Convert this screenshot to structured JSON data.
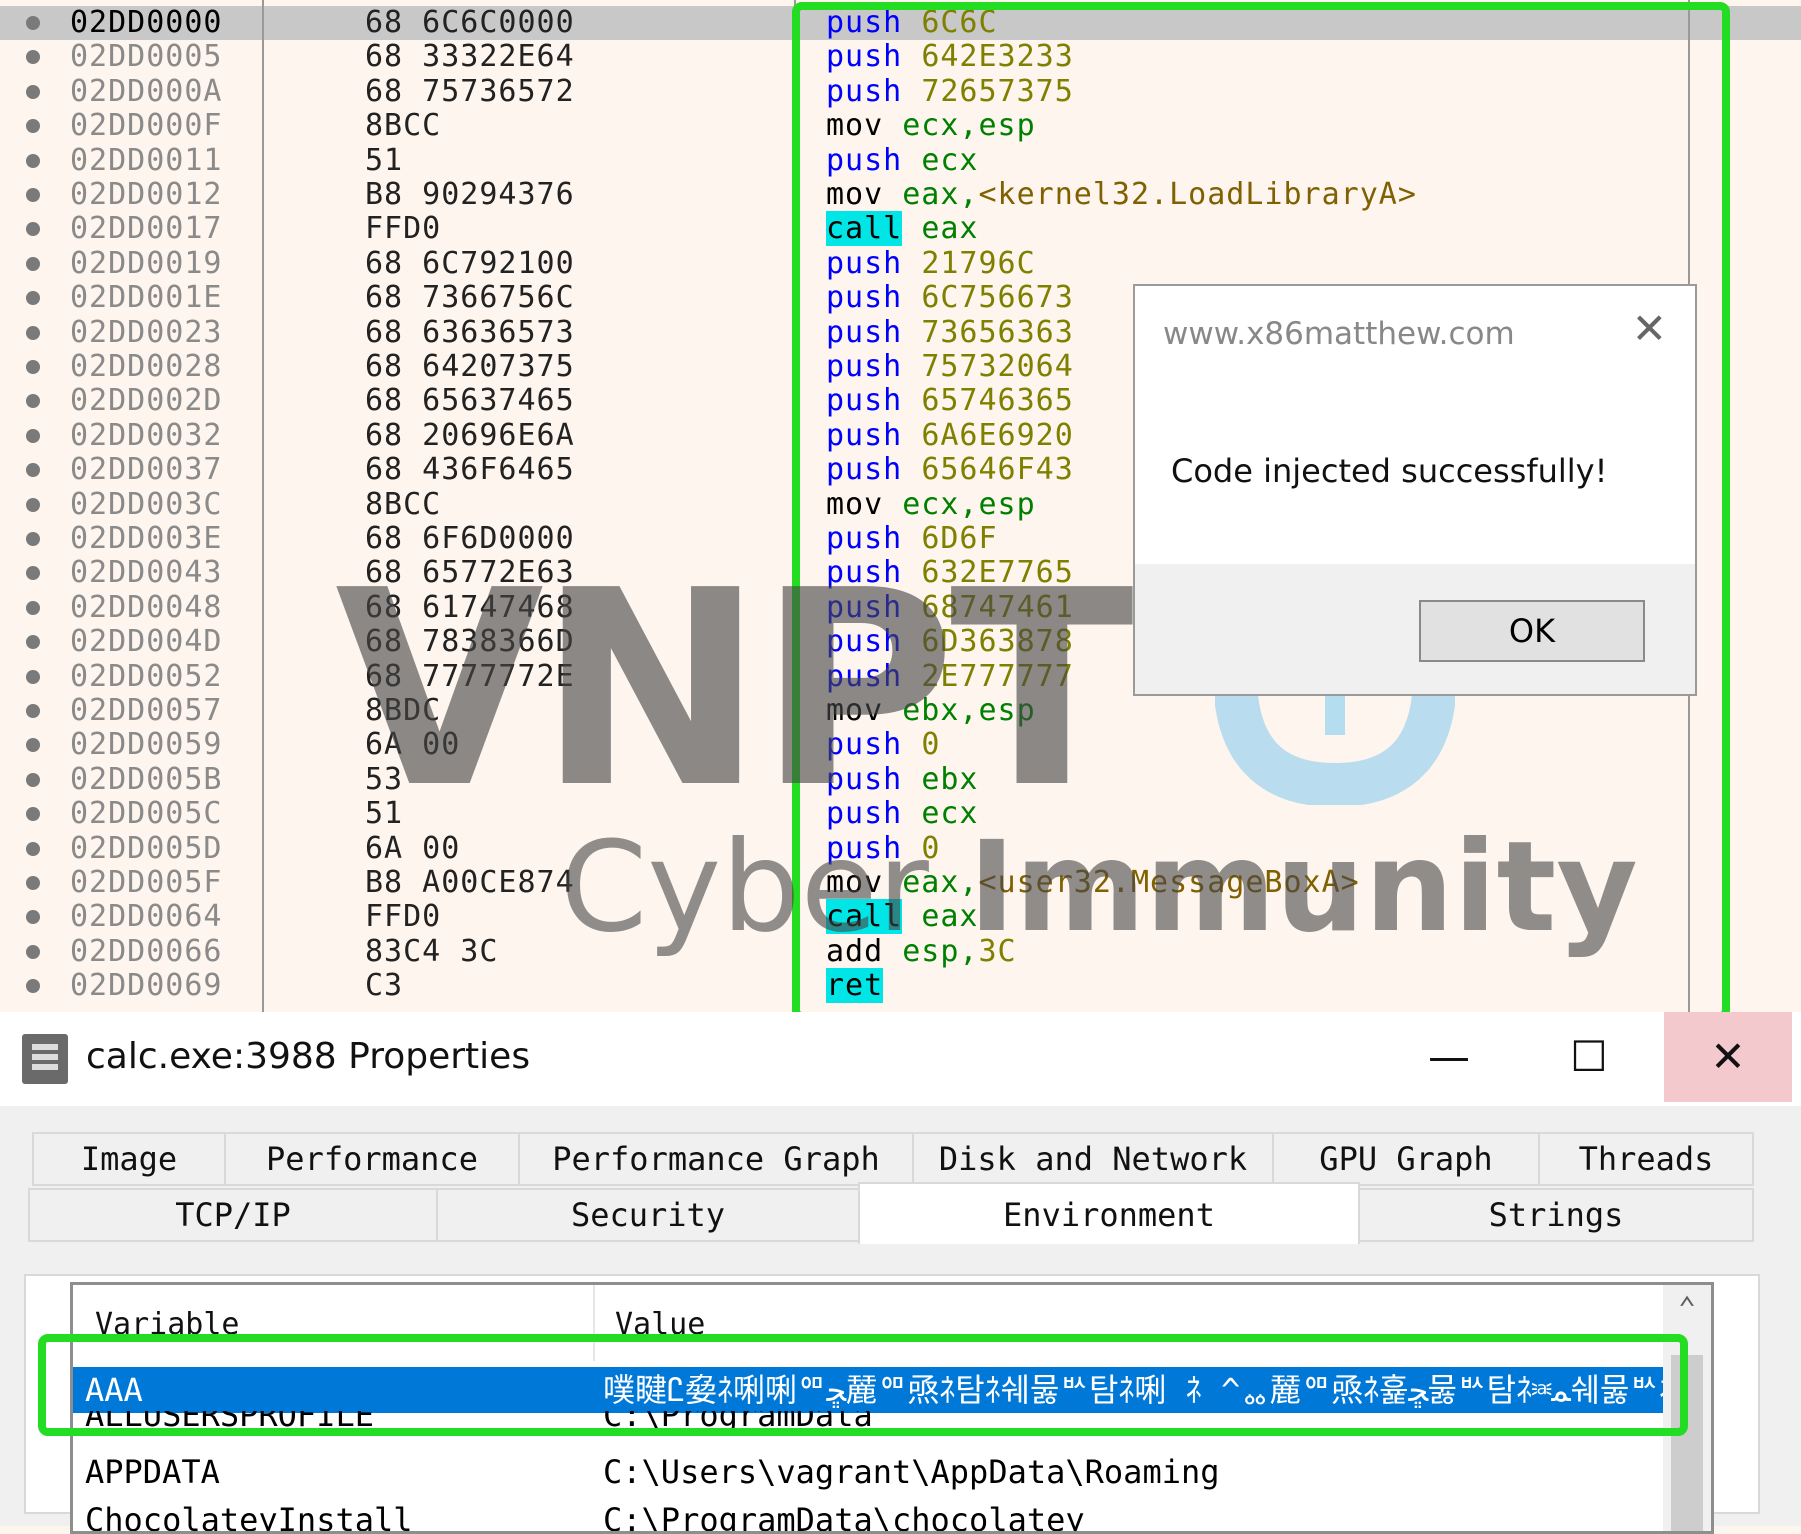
{
  "disasm": {
    "rows": [
      {
        "addr": "02DD0000",
        "bytes": "68 6C6C0000",
        "mn": "push",
        "ops": [
          {
            "t": "6C6C",
            "k": "imm"
          }
        ]
      },
      {
        "addr": "02DD0005",
        "bytes": "68 33322E64",
        "mn": "push",
        "ops": [
          {
            "t": "642E3233",
            "k": "imm"
          }
        ]
      },
      {
        "addr": "02DD000A",
        "bytes": "68 75736572",
        "mn": "push",
        "ops": [
          {
            "t": "72657375",
            "k": "imm"
          }
        ]
      },
      {
        "addr": "02DD000F",
        "bytes": "8BCC",
        "mn": "mov",
        "ops": [
          {
            "t": "ecx,esp",
            "k": "reg"
          }
        ]
      },
      {
        "addr": "02DD0011",
        "bytes": "51",
        "mn": "push",
        "ops": [
          {
            "t": "ecx",
            "k": "reg"
          }
        ]
      },
      {
        "addr": "02DD0012",
        "bytes": "B8 90294376",
        "mn": "mov",
        "ops": [
          {
            "t": "eax,",
            "k": "reg"
          },
          {
            "t": "<kernel32.LoadLibraryA>",
            "k": "sym"
          }
        ]
      },
      {
        "addr": "02DD0017",
        "bytes": "FFD0",
        "mn": "call",
        "hl": true,
        "ops": [
          {
            "t": "eax",
            "k": "reg"
          }
        ]
      },
      {
        "addr": "02DD0019",
        "bytes": "68 6C792100",
        "mn": "push",
        "ops": [
          {
            "t": "21796C",
            "k": "imm"
          }
        ]
      },
      {
        "addr": "02DD001E",
        "bytes": "68 7366756C",
        "mn": "push",
        "ops": [
          {
            "t": "6C756673",
            "k": "imm"
          }
        ]
      },
      {
        "addr": "02DD0023",
        "bytes": "68 63636573",
        "mn": "push",
        "ops": [
          {
            "t": "73656363",
            "k": "imm"
          }
        ]
      },
      {
        "addr": "02DD0028",
        "bytes": "68 64207375",
        "mn": "push",
        "ops": [
          {
            "t": "75732064",
            "k": "imm"
          }
        ]
      },
      {
        "addr": "02DD002D",
        "bytes": "68 65637465",
        "mn": "push",
        "ops": [
          {
            "t": "65746365",
            "k": "imm"
          }
        ]
      },
      {
        "addr": "02DD0032",
        "bytes": "68 20696E6A",
        "mn": "push",
        "ops": [
          {
            "t": "6A6E6920",
            "k": "imm"
          }
        ]
      },
      {
        "addr": "02DD0037",
        "bytes": "68 436F6465",
        "mn": "push",
        "ops": [
          {
            "t": "65646F43",
            "k": "imm"
          }
        ]
      },
      {
        "addr": "02DD003C",
        "bytes": "8BCC",
        "mn": "mov",
        "ops": [
          {
            "t": "ecx,esp",
            "k": "reg"
          }
        ]
      },
      {
        "addr": "02DD003E",
        "bytes": "68 6F6D0000",
        "mn": "push",
        "ops": [
          {
            "t": "6D6F",
            "k": "imm"
          }
        ]
      },
      {
        "addr": "02DD0043",
        "bytes": "68 65772E63",
        "mn": "push",
        "ops": [
          {
            "t": "632E7765",
            "k": "imm"
          }
        ]
      },
      {
        "addr": "02DD0048",
        "bytes": "68 61747468",
        "mn": "push",
        "ops": [
          {
            "t": "68747461",
            "k": "imm"
          }
        ]
      },
      {
        "addr": "02DD004D",
        "bytes": "68 7838366D",
        "mn": "push",
        "ops": [
          {
            "t": "6D363878",
            "k": "imm"
          }
        ]
      },
      {
        "addr": "02DD0052",
        "bytes": "68 7777772E",
        "mn": "push",
        "ops": [
          {
            "t": "2E777777",
            "k": "imm"
          }
        ]
      },
      {
        "addr": "02DD0057",
        "bytes": "8BDC",
        "mn": "mov",
        "ops": [
          {
            "t": "ebx,esp",
            "k": "reg"
          }
        ]
      },
      {
        "addr": "02DD0059",
        "bytes": "6A 00",
        "mn": "push",
        "ops": [
          {
            "t": "0",
            "k": "imm"
          }
        ]
      },
      {
        "addr": "02DD005B",
        "bytes": "53",
        "mn": "push",
        "ops": [
          {
            "t": "ebx",
            "k": "reg"
          }
        ]
      },
      {
        "addr": "02DD005C",
        "bytes": "51",
        "mn": "push",
        "ops": [
          {
            "t": "ecx",
            "k": "reg"
          }
        ]
      },
      {
        "addr": "02DD005D",
        "bytes": "6A 00",
        "mn": "push",
        "ops": [
          {
            "t": "0",
            "k": "imm"
          }
        ]
      },
      {
        "addr": "02DD005F",
        "bytes": "B8 A00CE874",
        "mn": "mov",
        "ops": [
          {
            "t": "eax,",
            "k": "reg"
          },
          {
            "t": "<user32.MessageBoxA>",
            "k": "sym"
          }
        ]
      },
      {
        "addr": "02DD0064",
        "bytes": "FFD0",
        "mn": "call",
        "hl": true,
        "ops": [
          {
            "t": "eax",
            "k": "reg"
          }
        ]
      },
      {
        "addr": "02DD0066",
        "bytes": "83C4 3C",
        "mn": "add",
        "ops": [
          {
            "t": "esp,",
            "k": "reg"
          },
          {
            "t": "3C",
            "k": "imm"
          }
        ]
      },
      {
        "addr": "02DD0069",
        "bytes": "C3",
        "mn": "ret",
        "hl": true,
        "ops": []
      }
    ]
  },
  "watermark": {
    "big": "VNPT",
    "small_a": "Cyber ",
    "small_b": "Immunity"
  },
  "msgbox": {
    "title": "www.x86matthew.com",
    "message": "Code injected successfully!",
    "ok_label": "OK",
    "close_glyph": "✕"
  },
  "window": {
    "title": "calc.exe:3988 Properties",
    "min_glyph": "—",
    "max_glyph": "☐",
    "close_glyph": "✕",
    "tabs_row1": [
      "Image",
      "Performance",
      "Performance Graph",
      "Disk and Network",
      "GPU Graph",
      "Threads"
    ],
    "tabs_row2": [
      "TCP/IP",
      "Security",
      "Environment",
      "Strings"
    ],
    "active_tab": "Environment",
    "columns": {
      "variable": "Variable",
      "value": "Value"
    },
    "rows": [
      {
        "variable": "AAA",
        "value": "噗睷Ꮭ姭ﾈ唎唎ᅃﮁ麉ᅃ焏ﾈ탐ﾈ쉐뭃ᄡ탐ﾈ唎 ﾈ ^ᇮ麉ᅃ焏ﾈ흁ﮁ뭃ᄡ탐ﾈ⎃ﻤ쉐뭃ᄡﾈ",
        "selected": true
      },
      {
        "variable": "ALLUSERSPROFILE",
        "value": "C:\\ProgramData"
      },
      {
        "variable": "APPDATA",
        "value": "C:\\Users\\vagrant\\AppData\\Roaming"
      },
      {
        "variable": "ChocolateyInstall",
        "value": "C:\\ProgramData\\chocolatey"
      }
    ]
  },
  "colors": {
    "highlight_box": "#22dd22",
    "selection": "#0078d7",
    "call_highlight": "#00e5e5"
  }
}
